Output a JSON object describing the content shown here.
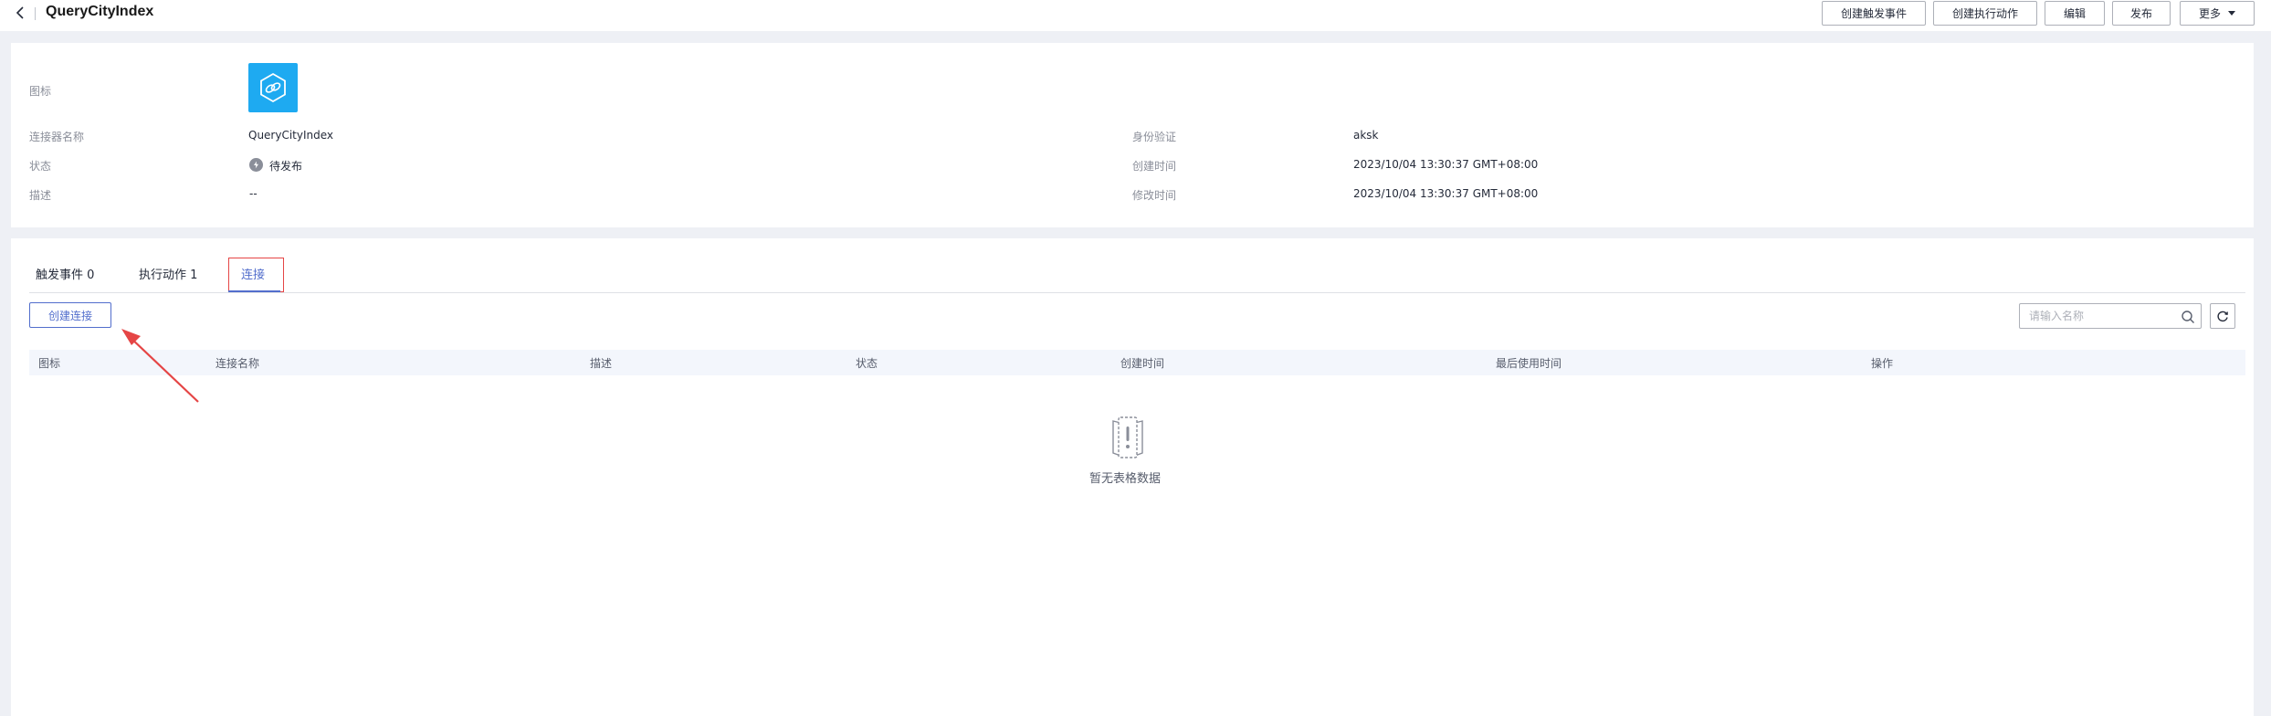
{
  "header": {
    "title": "QueryCityIndex",
    "buttons": {
      "create_trigger": "创建触发事件",
      "create_action": "创建执行动作",
      "edit": "编辑",
      "publish": "发布",
      "more": "更多"
    }
  },
  "info": {
    "icon_label": "图标",
    "name_label": "连接器名称",
    "name_value": "QueryCityIndex",
    "status_label": "状态",
    "status_value": "待发布",
    "desc_label": "描述",
    "desc_value": "--",
    "auth_label": "身份验证",
    "auth_value": "aksk",
    "created_label": "创建时间",
    "created_value": "2023/10/04 13:30:37 GMT+08:00",
    "modified_label": "修改时间",
    "modified_value": "2023/10/04 13:30:37 GMT+08:00"
  },
  "tabs": {
    "trigger": "触发事件 0",
    "action": "执行动作 1",
    "connection": "连接"
  },
  "toolbar": {
    "create_label": "创建连接",
    "search_placeholder": "请输入名称"
  },
  "table": {
    "columns": [
      "图标",
      "连接名称",
      "描述",
      "状态",
      "创建时间",
      "最后使用时间",
      "操作"
    ],
    "empty_text": "暂无表格数据"
  },
  "colors": {
    "accent": "#526ecc",
    "icon_bg": "#1eaaf1",
    "highlight_red": "#e54545"
  }
}
